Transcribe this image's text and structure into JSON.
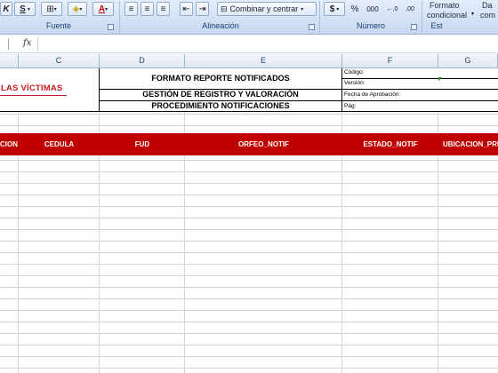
{
  "ribbon": {
    "fuente_label": "Fuente",
    "alineacion_label": "Alineación",
    "numero_label": "Número",
    "estilos_label": "Est",
    "combinar_label": "Combinar y centrar",
    "currency_symbol": "$",
    "percent_symbol": "%",
    "thousands_symbol": "000",
    "inc_decimal": "←,0",
    "dec_decimal": ",00",
    "formato_line1": "Formato",
    "formato_line2": "condicional",
    "dar_line1": "Da",
    "dar_line2": "com",
    "italic_k": "K",
    "font_color_letter": "A"
  },
  "formula_bar": {
    "fx": "fx",
    "value": ""
  },
  "columns": [
    "C",
    "D",
    "E",
    "F",
    "G"
  ],
  "sheet": {
    "logo_text": "LAS VÍCTIMAS",
    "title1": "FORMATO REPORTE NOTIFICADOS",
    "title2": "GESTIÓN DE REGISTRO Y VALORACIÓN",
    "title3": "PROCEDIMIENTO NOTIFICACIONES",
    "meta_codigo": "Código:",
    "meta_version": "Versión:",
    "meta_fecha": "Fecha de Aprobación:",
    "meta_pag": "Pág:",
    "headers": [
      "CION",
      "CEDULA",
      "FUD",
      "ORFEO_NOTIF",
      "ESTADO_NOTIF",
      "UBICACION_PRU"
    ]
  },
  "colors": {
    "header_red": "#c00000",
    "logo_red": "#c61c1c"
  }
}
